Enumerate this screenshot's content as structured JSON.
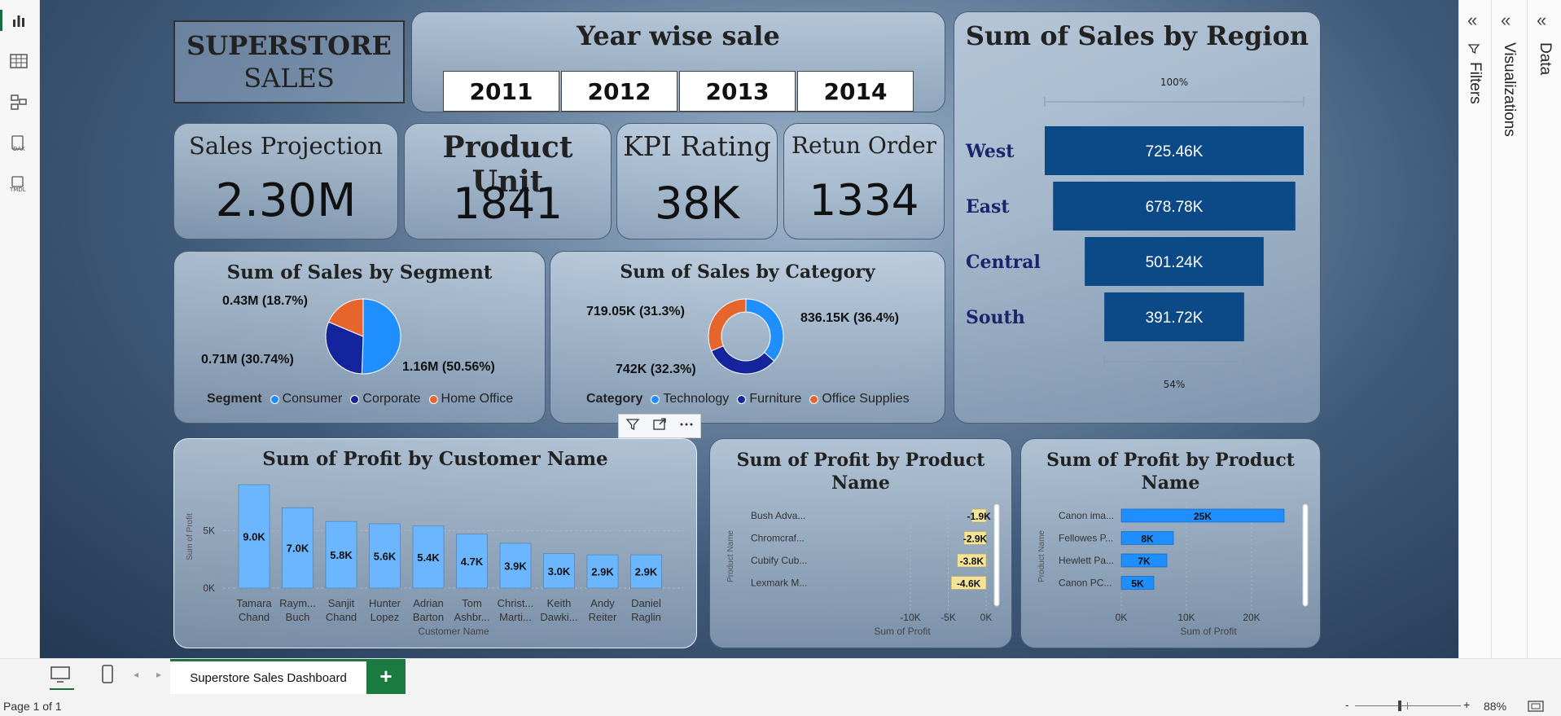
{
  "header": {
    "title_line1": "SUPERSTORE",
    "title_line2": "SALES"
  },
  "year_slicer": {
    "title": "Year wise sale",
    "years": [
      "2011",
      "2012",
      "2013",
      "2014"
    ]
  },
  "kpis": [
    {
      "title": "Sales Projection",
      "value": "2.30M"
    },
    {
      "title": "Product Unit",
      "value": "1841"
    },
    {
      "title": "KPI Rating",
      "value": "38K"
    },
    {
      "title": "Retun Order",
      "value": "1334"
    }
  ],
  "region_funnel": {
    "title": "Sum of Sales by Region",
    "top_pct": "100%",
    "bottom_pct": "54%",
    "rows": [
      {
        "label": "West",
        "value_label": "725.46K",
        "value": 725.46
      },
      {
        "label": "East",
        "value_label": "678.78K",
        "value": 678.78
      },
      {
        "label": "Central",
        "value_label": "501.24K",
        "value": 501.24
      },
      {
        "label": "South",
        "value_label": "391.72K",
        "value": 391.72
      }
    ],
    "bar_color": "#0b4a87"
  },
  "segment_pie": {
    "title": "Sum of Sales by Segment",
    "legend_title": "Segment",
    "slices": [
      {
        "name": "Consumer",
        "value": 50.56,
        "label": "1.16M (50.56%)",
        "color": "#1f8fff"
      },
      {
        "name": "Corporate",
        "value": 30.74,
        "label": "0.71M (30.74%)",
        "color": "#14249c"
      },
      {
        "name": "Home Office",
        "value": 18.7,
        "label": "0.43M (18.7%)",
        "color": "#e6652c"
      }
    ]
  },
  "category_donut": {
    "title": "Sum of Sales by Category",
    "legend_title": "Category",
    "slices": [
      {
        "name": "Technology",
        "value": 36.4,
        "label": "836.15K (36.4%)",
        "color": "#1f8fff"
      },
      {
        "name": "Furniture",
        "value": 32.3,
        "label": "742K (32.3%)",
        "color": "#14249c"
      },
      {
        "name": "Office Supplies",
        "value": 31.3,
        "label": "719.05K (31.3%)",
        "color": "#e6652c"
      }
    ]
  },
  "customer_profit": {
    "title": "Sum of Profit by Customer Name",
    "ylabel": "Sum of Profit",
    "xlabel": "Customer Name",
    "yticks": [
      "5K",
      "0K"
    ],
    "bar_color": "#6cb6ff",
    "customers": [
      {
        "line1": "Tamara",
        "line2": "Chand",
        "value": 9.0,
        "label": "9.0K"
      },
      {
        "line1": "Raym...",
        "line2": "Buch",
        "value": 7.0,
        "label": "7.0K"
      },
      {
        "line1": "Sanjit",
        "line2": "Chand",
        "value": 5.8,
        "label": "5.8K"
      },
      {
        "line1": "Hunter",
        "line2": "Lopez",
        "value": 5.6,
        "label": "5.6K"
      },
      {
        "line1": "Adrian",
        "line2": "Barton",
        "value": 5.4,
        "label": "5.4K"
      },
      {
        "line1": "Tom",
        "line2": "Ashbr...",
        "value": 4.7,
        "label": "4.7K"
      },
      {
        "line1": "Christ...",
        "line2": "Marti...",
        "value": 3.9,
        "label": "3.9K"
      },
      {
        "line1": "Keith",
        "line2": "Dawki...",
        "value": 3.0,
        "label": "3.0K"
      },
      {
        "line1": "Andy",
        "line2": "Reiter",
        "value": 2.9,
        "label": "2.9K"
      },
      {
        "line1": "Daniel",
        "line2": "Raglin",
        "value": 2.9,
        "label": "2.9K"
      }
    ]
  },
  "product_loss": {
    "title_line1": "Sum of Profit by Product",
    "title_line2": "Name",
    "ylabel": "Product Name",
    "xlabel": "Sum of Profit",
    "xticks": [
      "-10K",
      "-5K",
      "0K"
    ],
    "bar_color": "#f3e49a",
    "rows": [
      {
        "name": "Bush Adva...",
        "value": -1.9,
        "label": "-1.9K"
      },
      {
        "name": "Chromcraf...",
        "value": -2.9,
        "label": "-2.9K"
      },
      {
        "name": "Cubify Cub...",
        "value": -3.8,
        "label": "-3.8K"
      },
      {
        "name": "Lexmark M...",
        "value": -4.6,
        "label": "-4.6K"
      }
    ]
  },
  "product_profit": {
    "title_line1": "Sum of Profit by Product",
    "title_line2": "Name",
    "ylabel": "Product Name",
    "xlabel": "Sum of Profit",
    "xticks": [
      "0K",
      "10K",
      "20K"
    ],
    "bar_color": "#1f8fff",
    "rows": [
      {
        "name": "Canon ima...",
        "value": 25,
        "label": "25K"
      },
      {
        "name": "Fellowes P...",
        "value": 8,
        "label": "8K"
      },
      {
        "name": "Hewlett Pa...",
        "value": 7,
        "label": "7K"
      },
      {
        "name": "Canon PC...",
        "value": 5,
        "label": "5K"
      }
    ]
  },
  "chart_data": [
    {
      "type": "bar",
      "title": "Sum of Sales by Region",
      "categories": [
        "West",
        "East",
        "Central",
        "South"
      ],
      "values": [
        725.46,
        678.78,
        501.24,
        391.72
      ]
    },
    {
      "type": "pie",
      "title": "Sum of Sales by Segment",
      "categories": [
        "Consumer",
        "Corporate",
        "Home Office"
      ],
      "values": [
        1.16,
        0.71,
        0.43
      ]
    },
    {
      "type": "pie",
      "title": "Sum of Sales by Category",
      "categories": [
        "Technology",
        "Furniture",
        "Office Supplies"
      ],
      "values": [
        836.15,
        742,
        719.05
      ]
    },
    {
      "type": "bar",
      "title": "Sum of Profit by Customer Name",
      "xlabel": "Customer Name",
      "ylabel": "Sum of Profit",
      "categories": [
        "Tamara Chand",
        "Raym... Buch",
        "Sanjit Chand",
        "Hunter Lopez",
        "Adrian Barton",
        "Tom Ashbr...",
        "Christ... Marti...",
        "Keith Dawki...",
        "Andy Reiter",
        "Daniel Raglin"
      ],
      "values": [
        9.0,
        7.0,
        5.8,
        5.6,
        5.4,
        4.7,
        3.9,
        3.0,
        2.9,
        2.9
      ]
    },
    {
      "type": "bar",
      "title": "Sum of Profit by Product Name",
      "xlabel": "Sum of Profit",
      "ylabel": "Product Name",
      "categories": [
        "Bush Adva...",
        "Chromcraf...",
        "Cubify Cub...",
        "Lexmark M..."
      ],
      "values": [
        -1.9,
        -2.9,
        -3.8,
        -4.6
      ]
    },
    {
      "type": "bar",
      "title": "Sum of Profit by Product Name",
      "xlabel": "Sum of Profit",
      "ylabel": "Product Name",
      "categories": [
        "Canon ima...",
        "Fellowes P...",
        "Hewlett Pa...",
        "Canon PC..."
      ],
      "values": [
        25,
        8,
        7,
        5
      ]
    }
  ],
  "panes": {
    "filters": "Filters",
    "visualizations": "Visualizations",
    "data": "Data"
  },
  "footer": {
    "tab_label": "Superstore Sales Dashboard",
    "add_tab": "+",
    "page_status": "Page 1 of 1",
    "zoom": "88%",
    "zoom_minus": "-",
    "zoom_plus": "+"
  }
}
